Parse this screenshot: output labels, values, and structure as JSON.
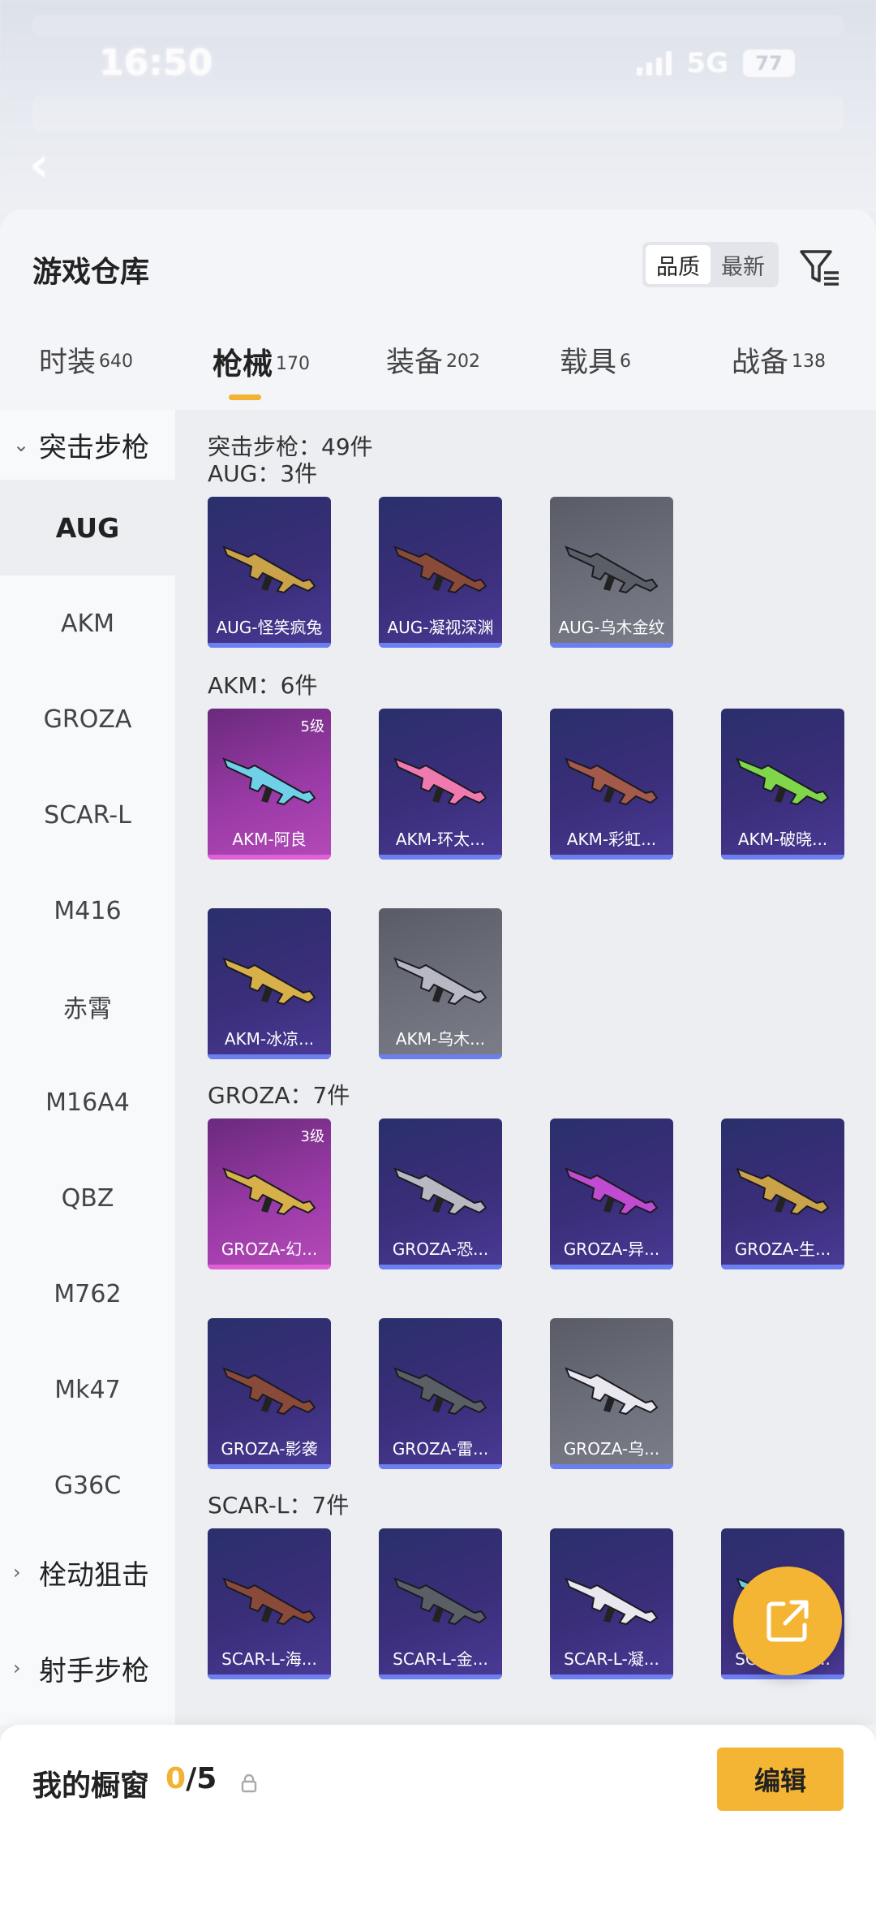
{
  "status_bar": {
    "time": "16:50",
    "network": "5G",
    "battery": "77"
  },
  "header": {
    "title": "游戏仓库",
    "sort_options": [
      "品质",
      "最新"
    ],
    "sort_active": 0
  },
  "tabs": [
    {
      "label": "时装",
      "count": "640"
    },
    {
      "label": "枪械",
      "count": "170",
      "active": true
    },
    {
      "label": "装备",
      "count": "202"
    },
    {
      "label": "载具",
      "count": "6"
    },
    {
      "label": "战备",
      "count": "138"
    }
  ],
  "sidebar": {
    "group_open": "突击步枪",
    "items": [
      "AUG",
      "AKM",
      "GROZA",
      "SCAR-L",
      "M416",
      "赤霄",
      "M16A4",
      "QBZ",
      "M762",
      "Mk47",
      "G36C"
    ],
    "active_item": "AUG",
    "collapsed_groups": [
      "栓动狙击",
      "射手步枪"
    ]
  },
  "content": {
    "category_total": "突击步枪：49件",
    "sections": [
      {
        "title": "AUG：3件",
        "cards": [
          {
            "label": "AUG-怪笑疯兔",
            "style": "blue"
          },
          {
            "label": "AUG-凝视深渊",
            "style": "blue"
          },
          {
            "label": "AUG-乌木金纹",
            "style": "gray"
          }
        ]
      },
      {
        "title": "AKM：6件",
        "cards": [
          {
            "label": "AKM-阿良",
            "style": "purple",
            "level": "5级"
          },
          {
            "label": "AKM-环太...",
            "style": "blue"
          },
          {
            "label": "AKM-彩虹...",
            "style": "blue"
          },
          {
            "label": "AKM-破晓...",
            "style": "blue"
          },
          {
            "label": "AKM-冰凉...",
            "style": "blue"
          },
          {
            "label": "AKM-乌木...",
            "style": "gray"
          }
        ]
      },
      {
        "title": "GROZA：7件",
        "cards": [
          {
            "label": "GROZA-幻...",
            "style": "purple",
            "level": "3级"
          },
          {
            "label": "GROZA-恐...",
            "style": "blue"
          },
          {
            "label": "GROZA-异...",
            "style": "blue"
          },
          {
            "label": "GROZA-生...",
            "style": "blue"
          },
          {
            "label": "GROZA-影袭",
            "style": "blue"
          },
          {
            "label": "GROZA-雷...",
            "style": "blue"
          },
          {
            "label": "GROZA-乌...",
            "style": "gray"
          }
        ]
      },
      {
        "title": "SCAR-L：7件",
        "cards": [
          {
            "label": "SCAR-L-海...",
            "style": "blue"
          },
          {
            "label": "SCAR-L-金...",
            "style": "blue"
          },
          {
            "label": "SCAR-L-凝...",
            "style": "blue"
          },
          {
            "label": "SCAR-L-雷...",
            "style": "blue"
          }
        ]
      }
    ]
  },
  "bottom": {
    "title": "我的橱窗",
    "count_current": "0",
    "count_total": "/5",
    "edit_label": "编辑"
  },
  "colors": {
    "accent": "#f5b534",
    "card_blue": "#3b2e7a",
    "card_purple": "#9a3aa6",
    "card_gray": "#6d707a"
  }
}
